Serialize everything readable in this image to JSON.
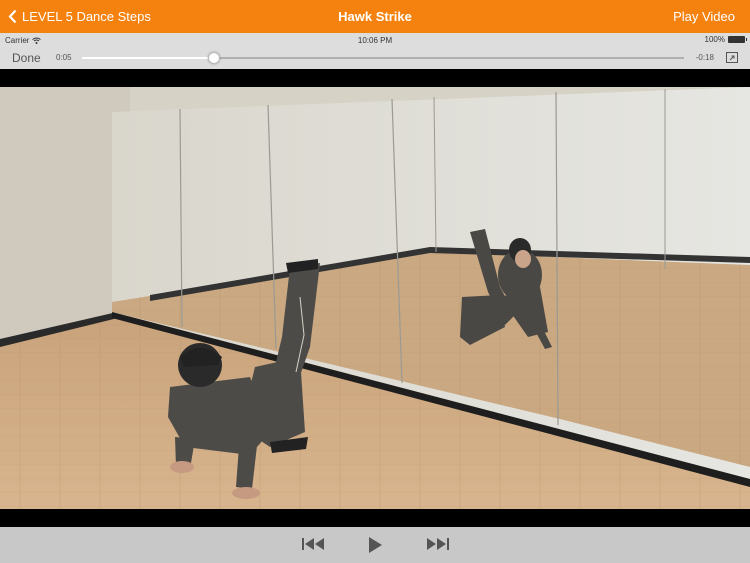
{
  "nav": {
    "back_label": "LEVEL 5 Dance Steps",
    "title": "Hawk Strike",
    "play_video_label": "Play Video",
    "color": "#f5820f"
  },
  "status": {
    "carrier": "Carrier",
    "time": "10:06 PM",
    "battery": "100%"
  },
  "player": {
    "done_label": "Done",
    "elapsed": "0:05",
    "remaining": "-0:18",
    "progress_fraction": 0.22
  },
  "video": {
    "description_icon": "video-frame"
  },
  "toolbar": {
    "icons": [
      "skip-back-icon",
      "play-icon",
      "skip-forward-icon"
    ]
  }
}
